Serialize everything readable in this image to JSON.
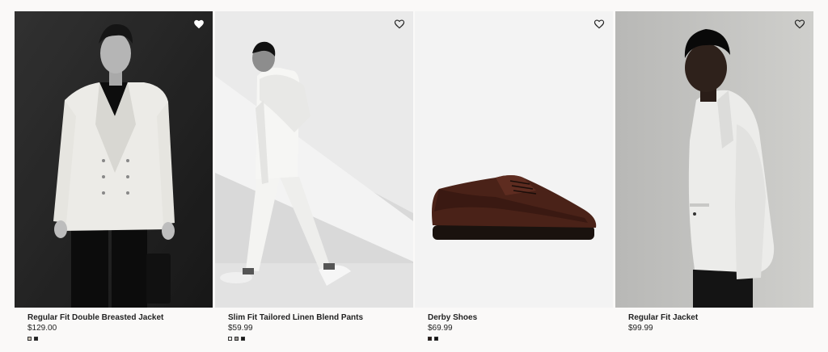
{
  "products": [
    {
      "name": "Regular Fit Double Breasted Jacket",
      "price": "$129.00",
      "swatches": [
        "#c9c1b4",
        "#222222"
      ]
    },
    {
      "name": "Slim Fit Tailored Linen Blend Pants",
      "price": "$59.99",
      "swatches": [
        "#f2f0ec",
        "#9a9690",
        "#1a1a1a"
      ]
    },
    {
      "name": "Derby Shoes",
      "price": "$69.99",
      "swatches": [
        "#2b1a14",
        "#111111"
      ]
    },
    {
      "name": "Regular Fit Jacket",
      "price": "$99.99",
      "swatches": []
    }
  ],
  "icons": {
    "favorite": "heart-icon"
  },
  "colors": {
    "background": "#faf9f8",
    "text": "#222222"
  }
}
